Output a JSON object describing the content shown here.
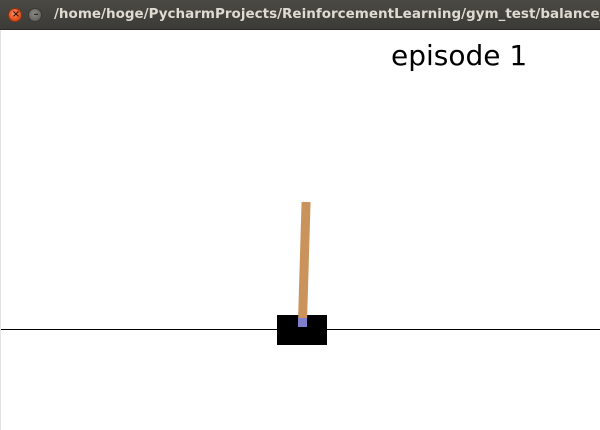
{
  "window": {
    "title": "/home/hoge/PycharmProjects/ReinforcementLearning/gym_test/balance_",
    "close_icon": "×",
    "minimize_icon": "–"
  },
  "scene": {
    "episode_label": "episode 1",
    "colors": {
      "background": "#ffffff",
      "track": "#000000",
      "cart": "#000000",
      "pole": "#c9935b",
      "axle": "#7f7fcc"
    }
  }
}
